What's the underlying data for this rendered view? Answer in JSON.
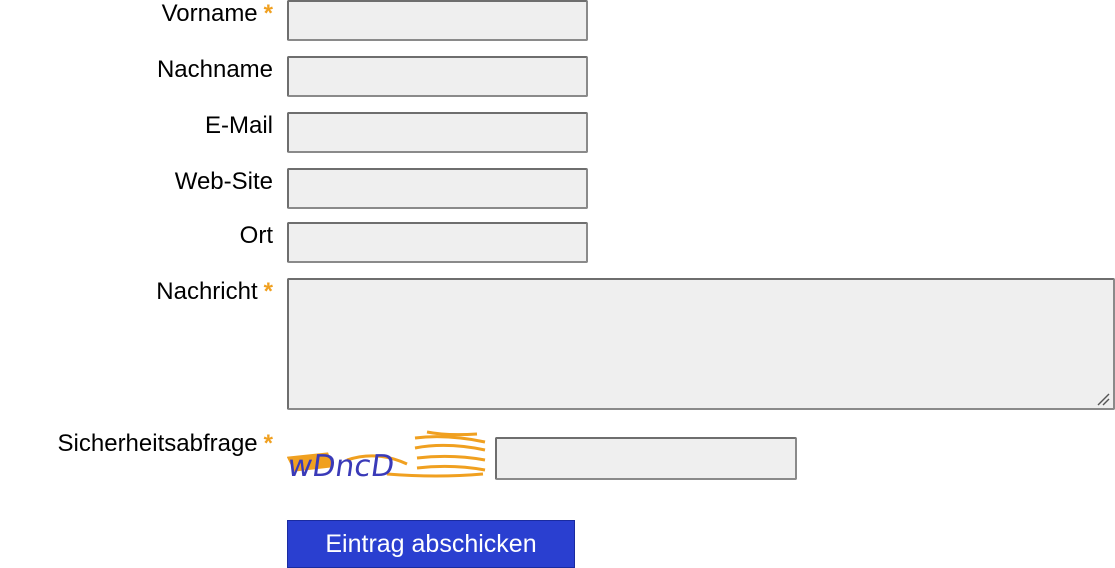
{
  "form": {
    "fields": {
      "vorname": {
        "label": "Vorname",
        "required_mark": "*",
        "value": ""
      },
      "nachname": {
        "label": "Nachname",
        "value": ""
      },
      "email": {
        "label": "E-Mail",
        "value": ""
      },
      "website": {
        "label": "Web-Site",
        "value": ""
      },
      "ort": {
        "label": "Ort",
        "value": ""
      },
      "nachricht": {
        "label": "Nachricht",
        "required_mark": "*",
        "value": ""
      },
      "sicherheitsabfrage": {
        "label": "Sicherheitsabfrage",
        "required_mark": "*",
        "value": ""
      }
    },
    "captcha": {
      "text": "wDncD",
      "ink_color": "#3a3ab8",
      "noise_color": "#f0a020"
    },
    "submit_label": "Eintrag abschicken"
  },
  "colors": {
    "required_mark": "#f0a020",
    "submit_bg": "#2a3fd0",
    "field_bg": "#efefef"
  }
}
